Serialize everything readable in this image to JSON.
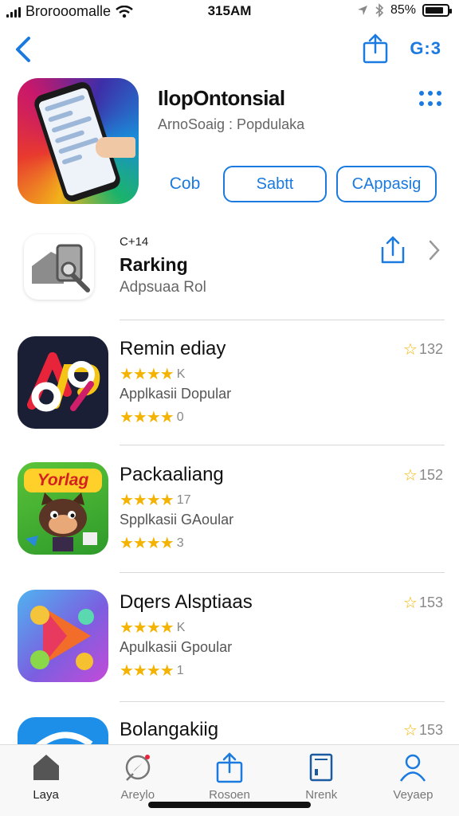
{
  "status_bar": {
    "carrier": "Brorooomalle",
    "time": "315AM",
    "battery_percent": "85%",
    "battery_level": 0.85
  },
  "nav": {
    "right_text": "G:3"
  },
  "hero": {
    "title": "IlopOntonsial",
    "subtitle": "ArnoSoaig : Popdulaka",
    "action_plain": "Cob",
    "action_outline_1": "Sabtt",
    "action_outline_2": "CAppasig"
  },
  "ranking": {
    "small_label": "C+14",
    "title": "Rarking",
    "subtitle": "Adpsuaa Rol"
  },
  "apps": [
    {
      "name": "Remin ediay",
      "stars_label_1": "K",
      "subtitle": "Applkasii Dopular",
      "stars_label_2": "0",
      "rating": "132"
    },
    {
      "name": "Packaaliang",
      "stars_label_1": "17",
      "subtitle": "Spplkasii GAoular",
      "stars_label_2": "3",
      "rating": "152"
    },
    {
      "name": "Dqers Alsptiaas",
      "stars_label_1": "K",
      "subtitle": "Apulkasii Gpoular",
      "stars_label_2": "1",
      "rating": "153"
    },
    {
      "name": "Bolangakiig",
      "rating": "153"
    }
  ],
  "icon_texts": {
    "packaging_logo": "Yorlag"
  },
  "tabs": [
    {
      "label": "Laya",
      "icon": "home-icon"
    },
    {
      "label": "Areylo",
      "icon": "compass-icon"
    },
    {
      "label": "Rosoen",
      "icon": "share-icon"
    },
    {
      "label": "Nrenk",
      "icon": "book-icon"
    },
    {
      "label": "Veyaep",
      "icon": "person-icon"
    }
  ],
  "colors": {
    "accent": "#1a7ae0",
    "star": "#f5b301"
  }
}
